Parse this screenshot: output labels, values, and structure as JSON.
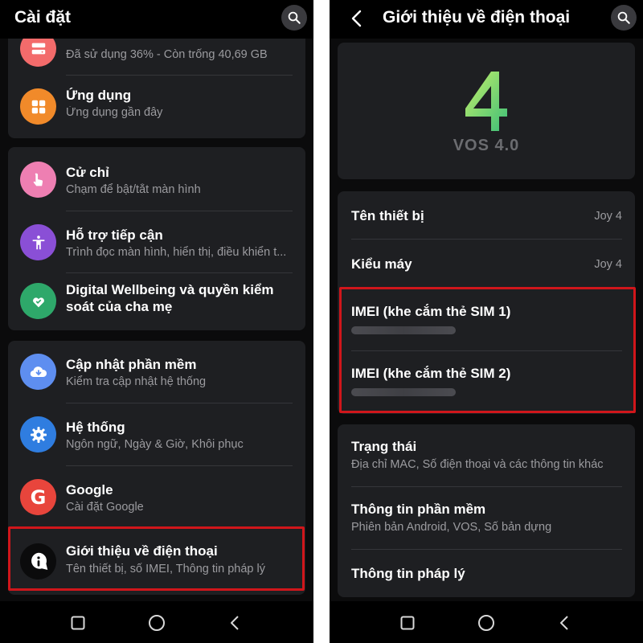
{
  "left": {
    "title": "Cài đặt",
    "storage_sub": "Đã sử dụng 36% - Còn trống 40,69 GB",
    "apps": {
      "title": "Ứng dụng",
      "sub": "Ứng dụng gần đây"
    },
    "gesture": {
      "title": "Cử chỉ",
      "sub": "Chạm để bật/tắt màn hình"
    },
    "accessibility": {
      "title": "Hỗ trợ tiếp cận",
      "sub": "Trình đọc màn hình, hiển thị, điều khiển t..."
    },
    "wellbeing": {
      "title_line1": "Digital Wellbeing và quyền kiểm",
      "title_line2": "soát của cha mẹ"
    },
    "update": {
      "title": "Cập nhật phần mềm",
      "sub": "Kiểm tra cập nhật hệ thống"
    },
    "system": {
      "title": "Hệ thống",
      "sub": "Ngôn ngữ, Ngày & Giờ, Khôi phục"
    },
    "google": {
      "title": "Google",
      "sub": "Cài đặt Google",
      "icon_letter": "G"
    },
    "about": {
      "title": "Giới thiệu về điện thoại",
      "sub": "Tên thiết bị, số IMEI, Thông tin pháp lý"
    }
  },
  "right": {
    "title": "Giới thiệu về điện thoại",
    "logo_text": "VOS 4.0",
    "device_name": {
      "label": "Tên thiết bị",
      "value": "Joy 4"
    },
    "model": {
      "label": "Kiểu máy",
      "value": "Joy 4"
    },
    "imei1": {
      "label": "IMEI (khe cắm thẻ SIM 1)"
    },
    "imei2": {
      "label": "IMEI (khe cắm thẻ SIM 2)"
    },
    "status": {
      "label": "Trạng thái",
      "sub": "Địa chỉ MAC, Số điện thoại và các thông tin khác"
    },
    "software": {
      "label": "Thông tin phần mềm",
      "sub": "Phiên bản Android, VOS, Số bản dựng"
    },
    "legal": {
      "label": "Thông tin pháp lý"
    }
  },
  "colors": {
    "highlight": "#d0161b",
    "card": "#1e1f22",
    "logo_green_light": "#b6e868",
    "logo_green_dark": "#3fbf77"
  },
  "icons": [
    "search-icon",
    "back-arrow-icon",
    "storage-icon",
    "apps-icon",
    "gesture-icon",
    "accessibility-icon",
    "wellbeing-icon",
    "cloud-download-icon",
    "settings-gear-icon",
    "google-icon",
    "info-icon",
    "square-nav-icon",
    "circle-nav-icon",
    "triangle-back-nav-icon"
  ]
}
